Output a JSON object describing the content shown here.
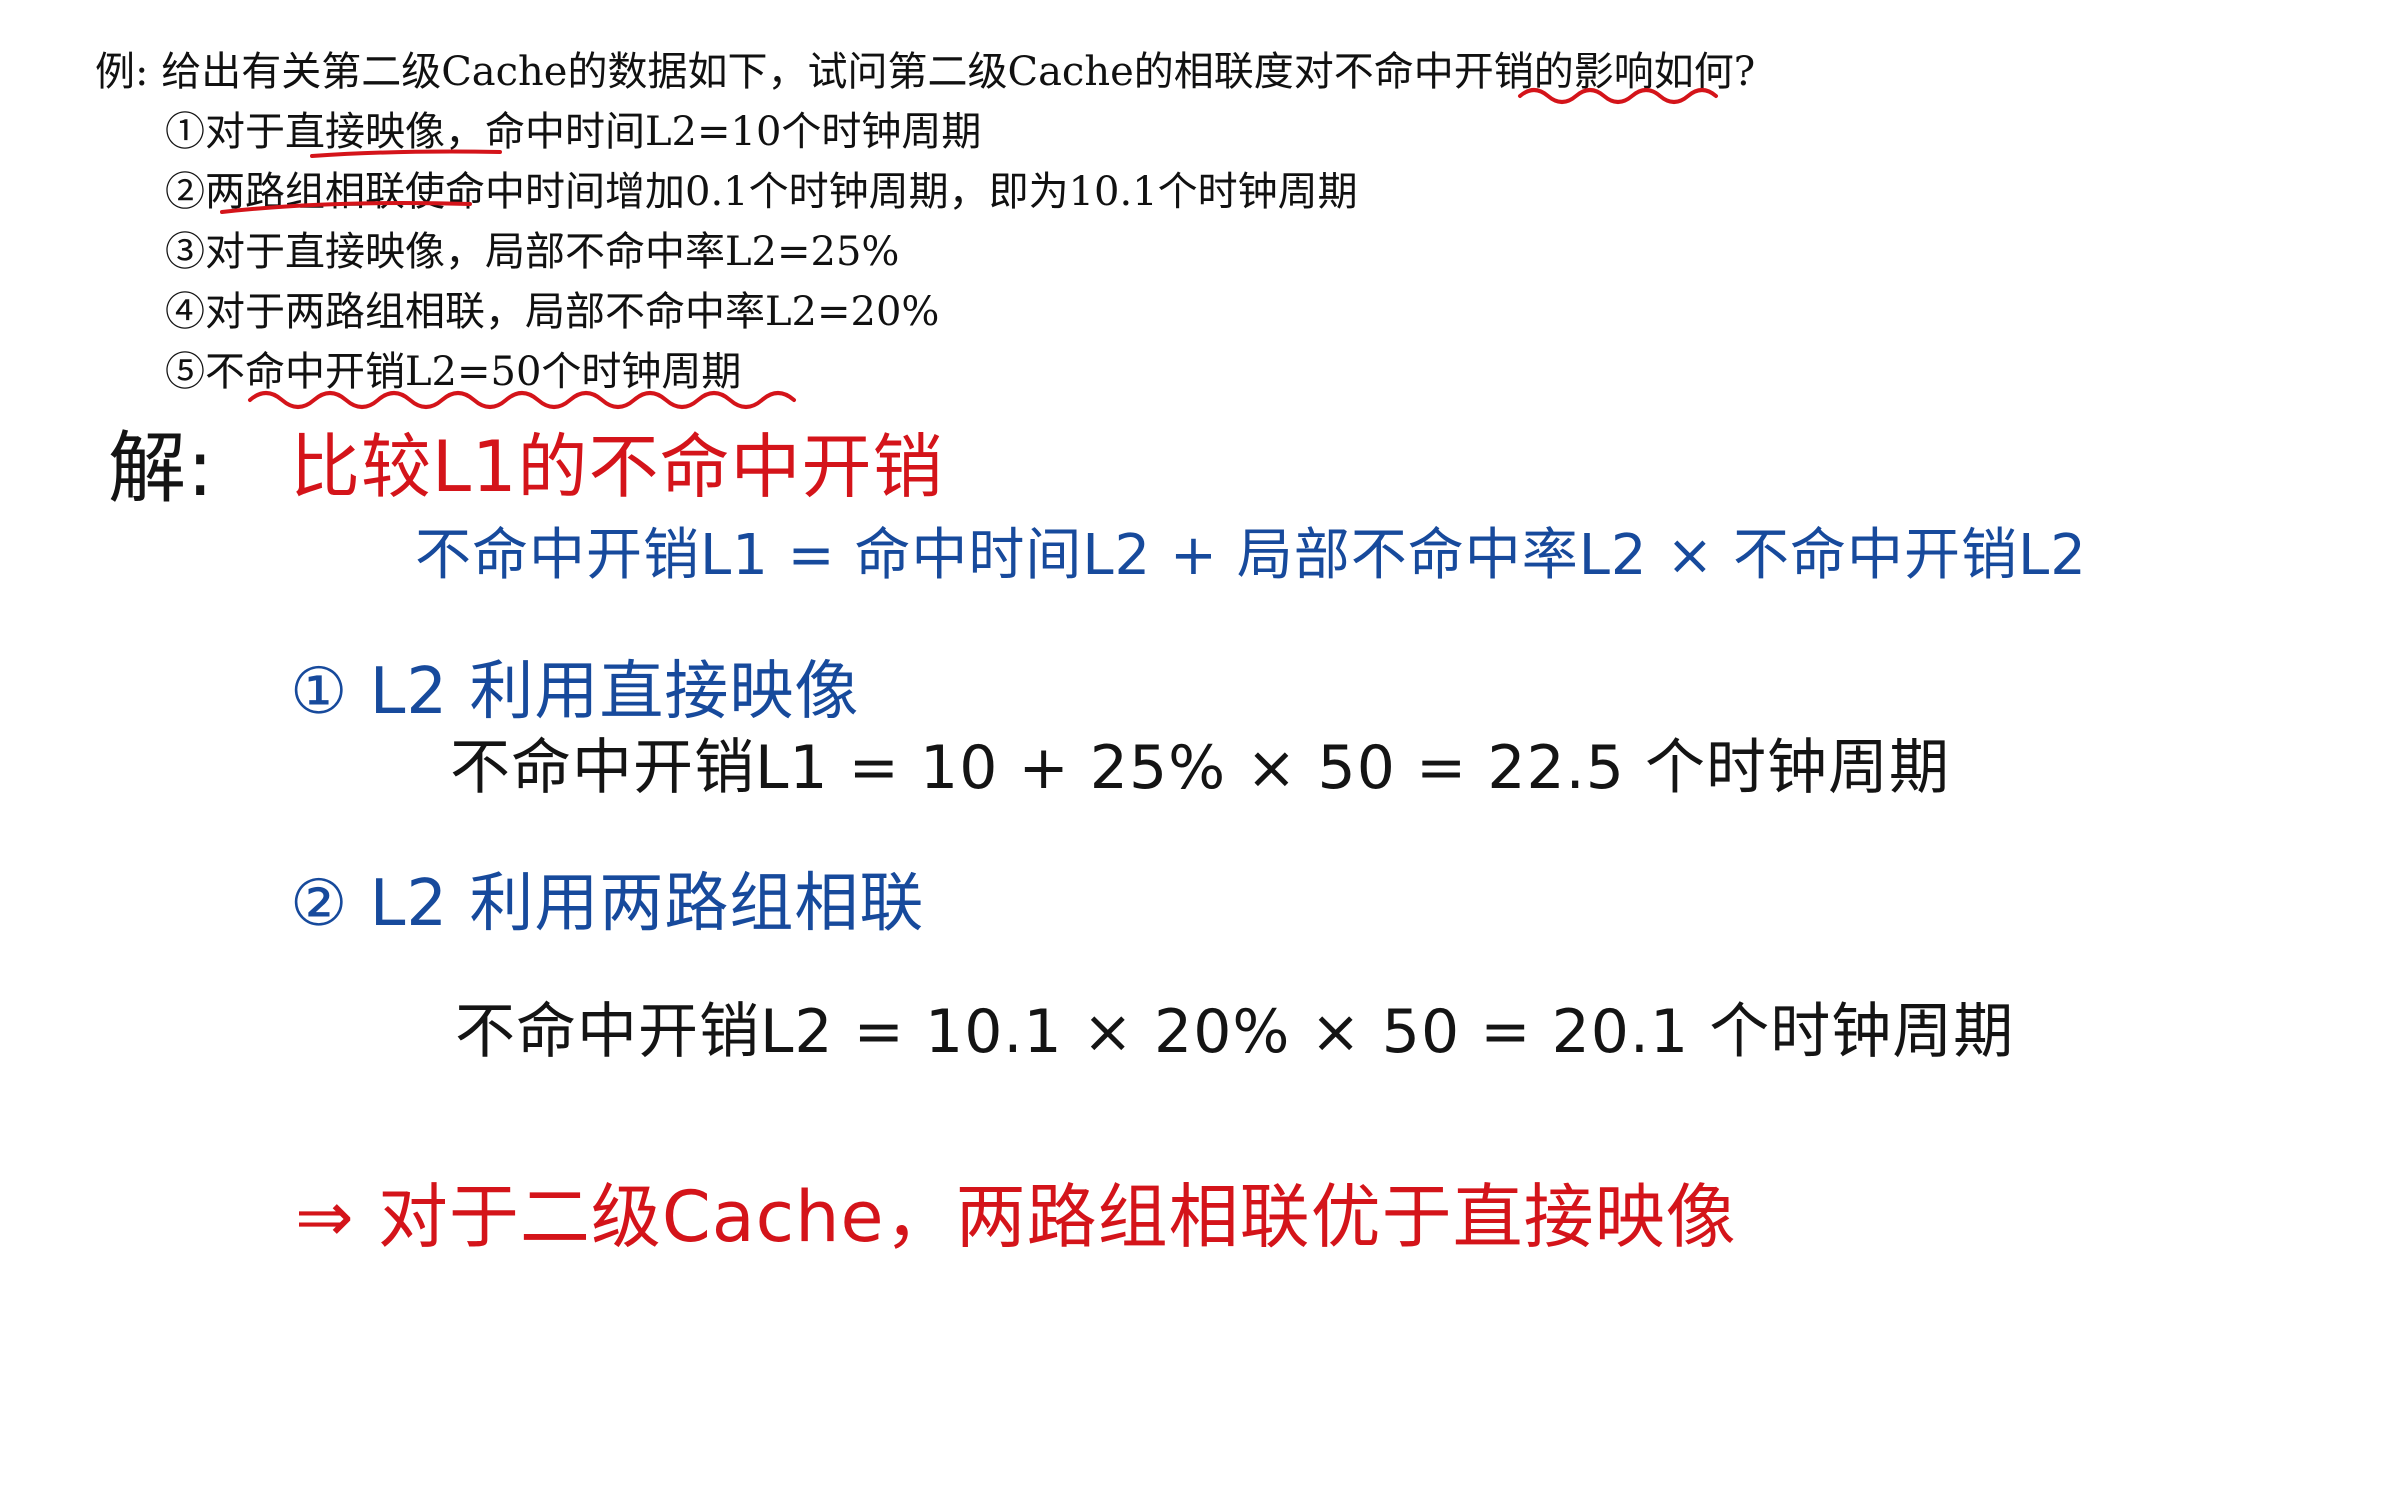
{
  "problem": {
    "title": "例: 给出有关第二级Cache的数据如下，试问第二级Cache的相联度对不命中开销的影响如何?",
    "items": [
      "①对于直接映像，命中时间L2=10个时钟周期",
      "②两路组相联使命中时间增加0.1个时钟周期，即为10.1个时钟周期",
      "③对于直接映像，局部不命中率L2=25%",
      "④对于两路组相联，局部不命中率L2=20%",
      "⑤不命中开销L2=50个时钟周期"
    ]
  },
  "solution": {
    "label": "解:",
    "heading": "比较L1的不命中开销",
    "formula": "不命中开销L1 = 命中时间L2 + 局部不命中率L2 × 不命中开销L2",
    "case1_title": "① L2 利用直接映像",
    "case1_calc": "不命中开销L1 = 10 + 25% × 50 = 22.5 个时钟周期",
    "case2_title": "② L2 利用两路组相联",
    "case2_calc": "不命中开销L2 = 10.1 × 20% × 50 = 20.1 个时钟周期",
    "conclusion": "⇒ 对于二级Cache，两路组相联优于直接映像"
  },
  "colors": {
    "printed_text": "#111111",
    "handwriting_black": "#141414",
    "handwriting_red": "#d4141a",
    "handwriting_blue": "#174a9c"
  }
}
